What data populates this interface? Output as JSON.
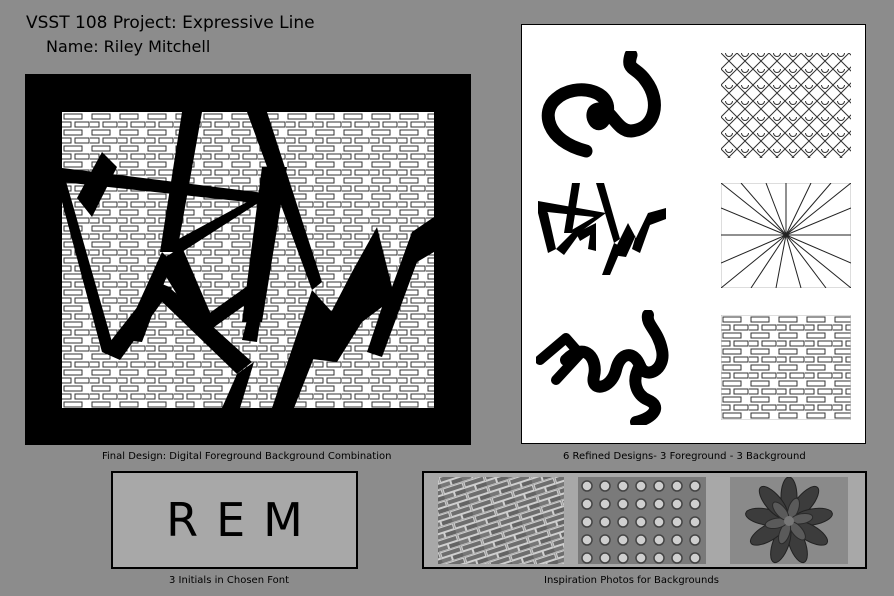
{
  "header": {
    "title": "VSST 108 Project: Expressive Line",
    "name_line": "Name: Riley Mitchell"
  },
  "final_design": {
    "caption": "Final Design: Digital Foreground Background Combination"
  },
  "refined_designs": {
    "caption": "6 Refined Designs- 3 Foreground - 3 Background"
  },
  "initials": {
    "text": "REM",
    "caption": "3 Initials in Chosen Font"
  },
  "inspiration": {
    "caption": "Inspiration Photos for Backgrounds"
  },
  "colors": {
    "page_background": "#8c8c8c",
    "panel_background": "#a8a8a8"
  }
}
